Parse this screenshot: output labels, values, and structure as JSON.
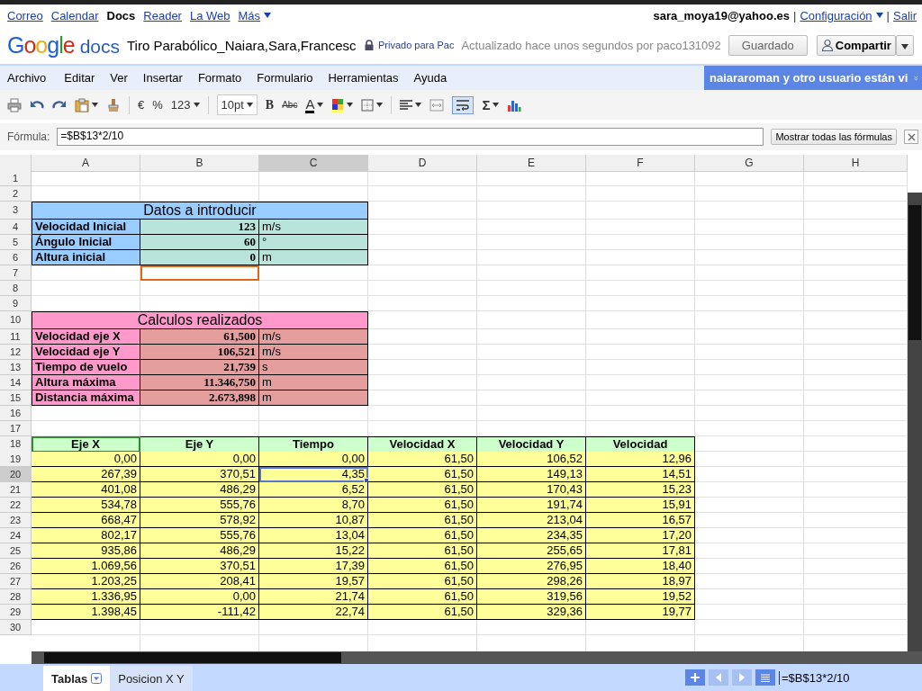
{
  "top_bar": {
    "links": [
      {
        "label": "Correo",
        "selected": false
      },
      {
        "label": "Calendar",
        "selected": false
      },
      {
        "label": "Docs",
        "selected": true
      },
      {
        "label": "Reader",
        "selected": false
      },
      {
        "label": "La Web",
        "selected": false
      }
    ],
    "more": "Más",
    "user": "sara_moya19@yahoo.es",
    "separators": [
      "|",
      "|"
    ],
    "settings": "Configuración",
    "sign_out": "Salir"
  },
  "header": {
    "logo": "Google",
    "product": "docs",
    "title": "Tiro Parabólico_Naiara,Sara,Francesc",
    "privacy": "Privado para Pac",
    "status": "Actualizado hace unos segundos por paco131092",
    "saved_button": "Guardado",
    "share_button": "Compartir"
  },
  "menu": {
    "items": [
      "Archivo",
      "Editar",
      "Ver",
      "Insertar",
      "Formato",
      "Formulario",
      "Herramientas",
      "Ayuda"
    ],
    "collaborators": "naiararoman y otro usuario están vi"
  },
  "toolbar": {
    "currency": "€",
    "percent": "%",
    "number_format": "123",
    "font_size": "10pt",
    "bold": "B",
    "strikethrough": "Abc",
    "text_color": "A",
    "sum": "Σ",
    "wrap_on": true
  },
  "formula_bar": {
    "label": "Fórmula:",
    "value": "=$B$13*2/10",
    "button": "Mostrar todas las fórmulas"
  },
  "sheet": {
    "columns": [
      {
        "label": "A",
        "selected": false
      },
      {
        "label": "B",
        "selected": false
      },
      {
        "label": "C",
        "selected": true
      },
      {
        "label": "D",
        "selected": false
      },
      {
        "label": "E",
        "selected": false
      },
      {
        "label": "F",
        "selected": false
      },
      {
        "label": "G",
        "selected": false
      },
      {
        "label": "H",
        "selected": false
      }
    ],
    "rows": [
      {
        "number": "1",
        "selected": false,
        "kind": "empty"
      },
      {
        "number": "2",
        "selected": false,
        "kind": "empty"
      },
      {
        "number": "3",
        "selected": false,
        "kind": "title",
        "color": "#99ccff",
        "text": "Datos a introducir"
      },
      {
        "number": "4",
        "selected": false,
        "kind": "field",
        "label": {
          "text": "Velocidad Inicial",
          "color": "#99ccff"
        },
        "value": {
          "text": "123",
          "color": "#b9e4dc"
        },
        "unit": "m/s"
      },
      {
        "number": "5",
        "selected": false,
        "kind": "field",
        "label": {
          "text": "Ángulo Inicial",
          "color": "#99ccff"
        },
        "value": {
          "text": "60",
          "color": "#b9e4dc"
        },
        "unit": "°"
      },
      {
        "number": "6",
        "selected": false,
        "kind": "field",
        "label": {
          "text": "Altura inicial",
          "color": "#99ccff"
        },
        "value": {
          "text": "0",
          "color": "#b9e4dc"
        },
        "unit": "m"
      },
      {
        "number": "7",
        "selected": false,
        "kind": "blank",
        "cells": [
          {
            "cursor": false
          },
          {
            "cursor": true,
            "color": "#e0661a"
          }
        ]
      },
      {
        "number": "8",
        "selected": false,
        "kind": "empty"
      },
      {
        "number": "9",
        "selected": false,
        "kind": "empty"
      },
      {
        "number": "10",
        "selected": false,
        "kind": "title",
        "color": "#ff99cc",
        "text": "Calculos realizados"
      },
      {
        "number": "11",
        "selected": false,
        "kind": "field",
        "label": {
          "text": "Velocidad eje X",
          "color": "#ff99cc"
        },
        "value": {
          "text": "61,500",
          "color": "#e59e9e"
        },
        "unit": "m/s"
      },
      {
        "number": "12",
        "selected": false,
        "kind": "field",
        "label": {
          "text": "Velocidad eje Y",
          "color": "#ff99cc"
        },
        "value": {
          "text": "106,521",
          "color": "#e59e9e"
        },
        "unit": "m/s"
      },
      {
        "number": "13",
        "selected": false,
        "kind": "field",
        "label": {
          "text": "Tiempo de vuelo",
          "color": "#ff99cc"
        },
        "value": {
          "text": "21,739",
          "color": "#e59e9e"
        },
        "unit": "s"
      },
      {
        "number": "14",
        "selected": false,
        "kind": "field",
        "label": {
          "text": "Altura máxima",
          "color": "#ff99cc"
        },
        "value": {
          "text": "11.346,750",
          "color": "#e59e9e"
        },
        "unit": "m"
      },
      {
        "number": "15",
        "selected": false,
        "kind": "field",
        "label": {
          "text": "Distancia máxima",
          "color": "#ff99cc"
        },
        "value": {
          "text": "2.673,898",
          "color": "#e59e9e"
        },
        "unit": "m"
      },
      {
        "number": "16",
        "selected": false,
        "kind": "empty"
      },
      {
        "number": "17",
        "selected": false,
        "kind": "empty"
      },
      {
        "number": "18",
        "selected": false,
        "kind": "header",
        "cells": [
          {
            "text": "Eje X",
            "cursor": true,
            "color": "#2e8b2e"
          },
          {
            "text": "Eje Y",
            "cursor": false
          },
          {
            "text": "Tiempo",
            "cursor": false
          },
          {
            "text": "Velocidad X",
            "cursor": false
          },
          {
            "text": "Velocidad Y",
            "cursor": false
          },
          {
            "text": "Velocidad",
            "cursor": false
          }
        ]
      },
      {
        "number": "19",
        "selected": false,
        "kind": "data",
        "cells": [
          "0,00",
          "0,00",
          "0,00",
          "61,50",
          "106,52",
          "12,96"
        ]
      },
      {
        "number": "20",
        "selected": true,
        "kind": "data",
        "cells": [
          "267,39",
          "370,51",
          "4,35",
          "61,50",
          "149,13",
          "14,51"
        ]
      },
      {
        "number": "21",
        "selected": false,
        "kind": "data",
        "cells": [
          "401,08",
          "486,29",
          "6,52",
          "61,50",
          "170,43",
          "15,23"
        ]
      },
      {
        "number": "22",
        "selected": false,
        "kind": "data",
        "cells": [
          "534,78",
          "555,76",
          "8,70",
          "61,50",
          "191,74",
          "15,91"
        ]
      },
      {
        "number": "23",
        "selected": false,
        "kind": "data",
        "cells": [
          "668,47",
          "578,92",
          "10,87",
          "61,50",
          "213,04",
          "16,57"
        ]
      },
      {
        "number": "24",
        "selected": false,
        "kind": "data",
        "cells": [
          "802,17",
          "555,76",
          "13,04",
          "61,50",
          "234,35",
          "17,20"
        ]
      },
      {
        "number": "25",
        "selected": false,
        "kind": "data",
        "cells": [
          "935,86",
          "486,29",
          "15,22",
          "61,50",
          "255,65",
          "17,81"
        ]
      },
      {
        "number": "26",
        "selected": false,
        "kind": "data",
        "cells": [
          "1.069,56",
          "370,51",
          "17,39",
          "61,50",
          "276,95",
          "18,40"
        ]
      },
      {
        "number": "27",
        "selected": false,
        "kind": "data",
        "cells": [
          "1.203,25",
          "208,41",
          "19,57",
          "61,50",
          "298,26",
          "18,97"
        ]
      },
      {
        "number": "28",
        "selected": false,
        "kind": "data",
        "cells": [
          "1.336,95",
          "0,00",
          "21,74",
          "61,50",
          "319,56",
          "19,52"
        ]
      },
      {
        "number": "29",
        "selected": false,
        "kind": "data",
        "cells": [
          "1.398,45",
          "-111,42",
          "22,74",
          "61,50",
          "329,36",
          "19,77"
        ]
      },
      {
        "number": "30",
        "selected": false,
        "kind": "empty"
      }
    ]
  },
  "sheet_tabs": [
    {
      "label": "Tablas",
      "selected": true
    },
    {
      "label": "Posicion X Y",
      "selected": false
    }
  ],
  "status_formula": "=$B$13*2/10"
}
